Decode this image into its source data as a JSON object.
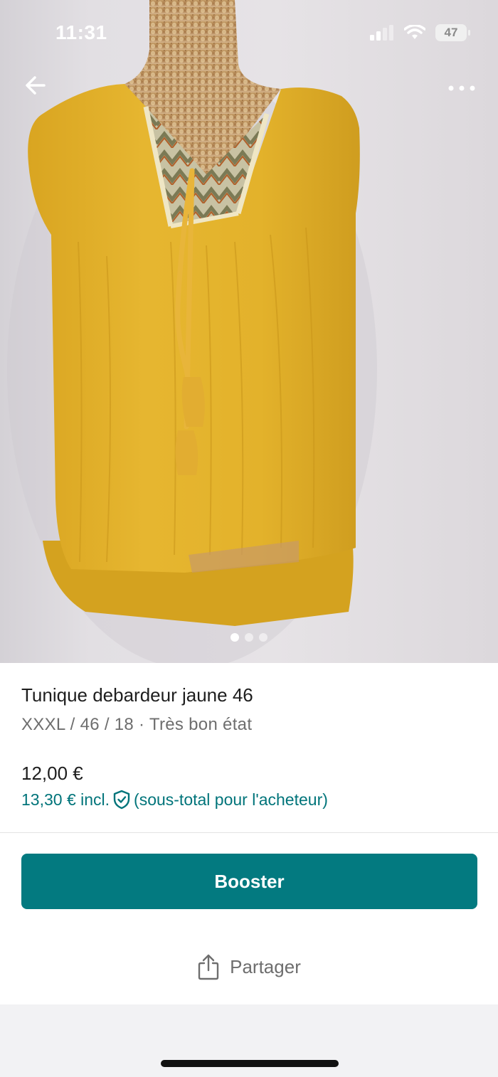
{
  "status_bar": {
    "time": "11:31",
    "battery": "47"
  },
  "nav": {
    "back_icon": "arrow-left-icon",
    "more_icon": "more-horizontal-icon"
  },
  "gallery": {
    "image_count": 3,
    "active_index": 0
  },
  "item": {
    "title": "Tunique debardeur jaune 46",
    "subtitle": "XXXL / 46 / 18 · Très bon état",
    "price": "12,00 €",
    "price_incl": "13,30 € incl.",
    "price_incl_note": "(sous-total pour l'acheteur)",
    "protection_icon": "shield-check-icon"
  },
  "actions": {
    "booster_label": "Booster",
    "share_label": "Partager",
    "share_icon": "share-icon"
  },
  "colors": {
    "accent": "#037a80",
    "link": "#00747a",
    "garment": "#e3b42c"
  }
}
